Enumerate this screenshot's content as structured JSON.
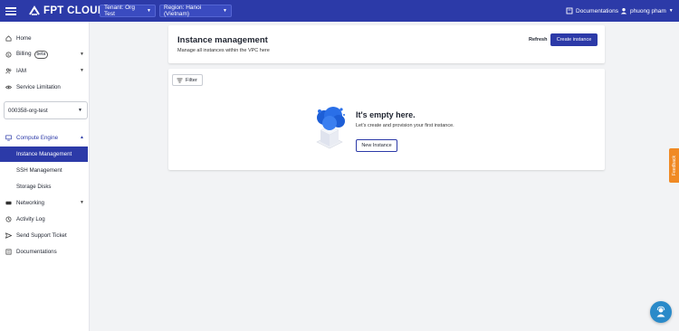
{
  "topbar": {
    "logo_text": "FPT CLOUD",
    "tenant_label": "Tenant: Org Test",
    "region_label": "Region: Hanoi (Vietnam)",
    "documentations": "Documentations",
    "user": "phuong pham"
  },
  "sidebar": {
    "home": "Home",
    "billing": "Billing",
    "billing_badge": "beta",
    "iam": "IAM",
    "service_limitation": "Service Limitation",
    "org_select": "000358-org-test",
    "compute_engine": "Compute Engine",
    "instance_management": "Instance Management",
    "ssh_management": "SSH Management",
    "storage_disks": "Storage Disks",
    "networking": "Networking",
    "activity_log": "Activity Log",
    "send_support_ticket": "Send Support Ticket",
    "documentations": "Documentations"
  },
  "header": {
    "title": "Instance management",
    "subtitle": "Manage all instances within the VPC here",
    "refresh_label": "Refresh",
    "create_label": "Create instance"
  },
  "content": {
    "filter_label": "Filter",
    "empty_title": "It's empty here.",
    "empty_desc": "Let's create and provision your first instance.",
    "new_label": "New Instance"
  },
  "feedback_label": "Feedback",
  "colors": {
    "brand": "#2c3aa8",
    "feedback": "#f08a24",
    "chat": "#2a8ac9"
  }
}
